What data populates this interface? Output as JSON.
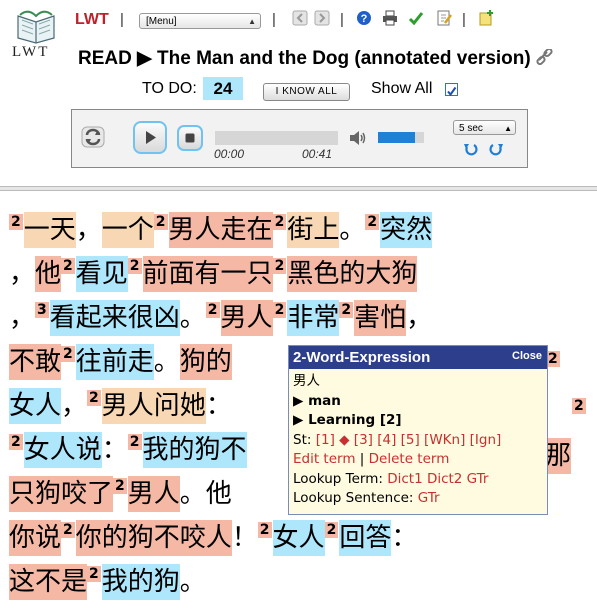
{
  "header": {
    "app_name": "LWT",
    "logo_text": "LWT",
    "separator": "|",
    "menu_select": "[Menu]",
    "toolbar_icons": [
      "previous-text-icon",
      "next-text-icon",
      "help-icon",
      "print-icon",
      "check-icon",
      "edit-text-icon",
      "new-text-icon"
    ]
  },
  "read": {
    "prefix": "READ ▶",
    "title": "The Man and the Dog (annotated version)",
    "todo_label": "TO DO:",
    "todo_count": "24",
    "iknow_button": "I KNOW ALL",
    "show_all_label": "Show All"
  },
  "player": {
    "current_time": "00:00",
    "duration": "00:41",
    "speed": "5 sec",
    "volume_level": 0.8
  },
  "colors": {
    "status1": "#f5b8a4",
    "status2": "#f8d8b4",
    "status3": "#fce3b0",
    "unknown": "#aee6fb",
    "popup_header": "#2d3f8c",
    "popup_link": "#c83030"
  },
  "reading_lines": [
    [
      {
        "c": "2"
      },
      {
        "t": "一天",
        "s": "st2"
      },
      {
        "t": "，",
        "s": ""
      },
      {
        "t": "一个",
        "s": "st2"
      },
      {
        "c": "2"
      },
      {
        "t": "男人走在",
        "s": "st1"
      },
      {
        "c": "2"
      },
      {
        "t": "街上",
        "s": "st2"
      },
      {
        "t": "。",
        "s": ""
      },
      {
        "c": "2"
      },
      {
        "t": "突然",
        "s": "st0"
      }
    ],
    [
      {
        "t": "，",
        "s": ""
      },
      {
        "t": "他",
        "s": "st1"
      },
      {
        "c": "2"
      },
      {
        "t": "看见",
        "s": "st0"
      },
      {
        "c": "2"
      },
      {
        "t": "前面有一只",
        "s": "st1"
      },
      {
        "c": "2"
      },
      {
        "t": "黑色的大狗",
        "s": "st1"
      }
    ],
    [
      {
        "t": "，",
        "s": ""
      },
      {
        "c": "3"
      },
      {
        "t": "看起来很凶",
        "s": "st0"
      },
      {
        "t": "。",
        "s": ""
      },
      {
        "c": "2"
      },
      {
        "t": "男人",
        "s": "st1"
      },
      {
        "c": "2"
      },
      {
        "t": "非常",
        "s": "st0"
      },
      {
        "c": "2"
      },
      {
        "t": "害怕",
        "s": "st1"
      },
      {
        "t": "，",
        "s": ""
      }
    ],
    [
      {
        "t": "不敢",
        "s": "st1"
      },
      {
        "c": "2"
      },
      {
        "t": "往前走",
        "s": "st0"
      },
      {
        "t": "。",
        "s": ""
      },
      {
        "t": "狗的",
        "s": "st1"
      }
    ],
    [
      {
        "t": "女人",
        "s": "st0"
      },
      {
        "t": "，",
        "s": ""
      },
      {
        "c": "2"
      },
      {
        "t": "男人问她",
        "s": "st2"
      },
      {
        "t": "：",
        "s": ""
      }
    ],
    [
      {
        "c": "2"
      },
      {
        "t": "女人说",
        "s": "st0"
      },
      {
        "t": "：",
        "s": ""
      },
      {
        "c": "2"
      },
      {
        "t": "我的狗不",
        "s": "st0"
      }
    ],
    [
      {
        "t": "只狗咬了",
        "s": "st1"
      },
      {
        "c": "2"
      },
      {
        "t": "男人",
        "s": "st1"
      },
      {
        "t": "。他",
        "s": ""
      }
    ],
    [
      {
        "t": "你说",
        "s": "st1"
      },
      {
        "c": "2"
      },
      {
        "t": "你的狗不咬人",
        "s": "st1"
      },
      {
        "t": "！",
        "s": ""
      },
      {
        "c": "2"
      },
      {
        "t": "女人",
        "s": "st0"
      },
      {
        "c": "2"
      },
      {
        "t": "回答",
        "s": "st0"
      },
      {
        "t": "：",
        "s": ""
      }
    ],
    [
      {
        "t": "这不是",
        "s": "st1"
      },
      {
        "c": "2"
      },
      {
        "t": "我的狗",
        "s": "st0"
      },
      {
        "t": "。",
        "s": ""
      }
    ]
  ],
  "right_fragments": {
    "line4_count": "2",
    "line5_end": "。",
    "line5_count": "2",
    "line6_end": "那"
  },
  "popup": {
    "header": "2-Word-Expression",
    "close": "Close",
    "term": "男人",
    "translation": "▶ man",
    "status_line": "▶ Learning [2]",
    "st_label": "St:",
    "st_items": "[1] ◆ [3] [4] [5] [WKn] [Ign]",
    "edit_term": "Edit term",
    "delete_term": "Delete term",
    "lookup_term_label": "Lookup Term:",
    "lookup_term_links": "Dict1 Dict2 GTr",
    "lookup_sentence_label": "Lookup Sentence:",
    "lookup_sentence_link": "GTr"
  }
}
